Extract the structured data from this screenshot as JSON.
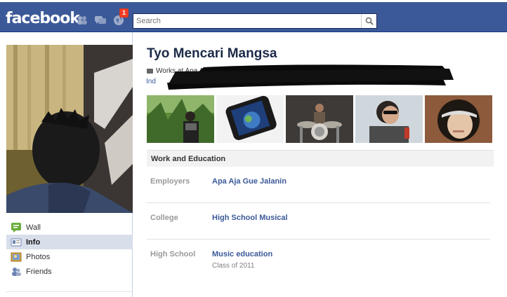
{
  "header": {
    "logo": "facebook",
    "notification_count": "1",
    "search_placeholder": "Search"
  },
  "profile": {
    "name": "Tyo Mencari Mangsa",
    "work_line": "Works at Apa Aja Gue Jalanin",
    "location_link": "Ind"
  },
  "nav": {
    "items": [
      {
        "label": "Wall",
        "icon": "wall-icon"
      },
      {
        "label": "Info",
        "icon": "info-icon"
      },
      {
        "label": "Photos",
        "icon": "photos-icon"
      },
      {
        "label": "Friends",
        "icon": "friends-icon"
      }
    ]
  },
  "info": {
    "section_title": "Work and Education",
    "rows": [
      {
        "label": "Employers",
        "value": "Apa Aja Gue Jalanin",
        "sub": ""
      },
      {
        "label": "College",
        "value": "High School Musical",
        "sub": ""
      },
      {
        "label": "High School",
        "value": "Music education",
        "sub": "Class of 2011"
      }
    ]
  },
  "colors": {
    "brand_blue": "#3b5998",
    "nav_active": "#d8dfea",
    "badge_red": "#f03d25"
  }
}
